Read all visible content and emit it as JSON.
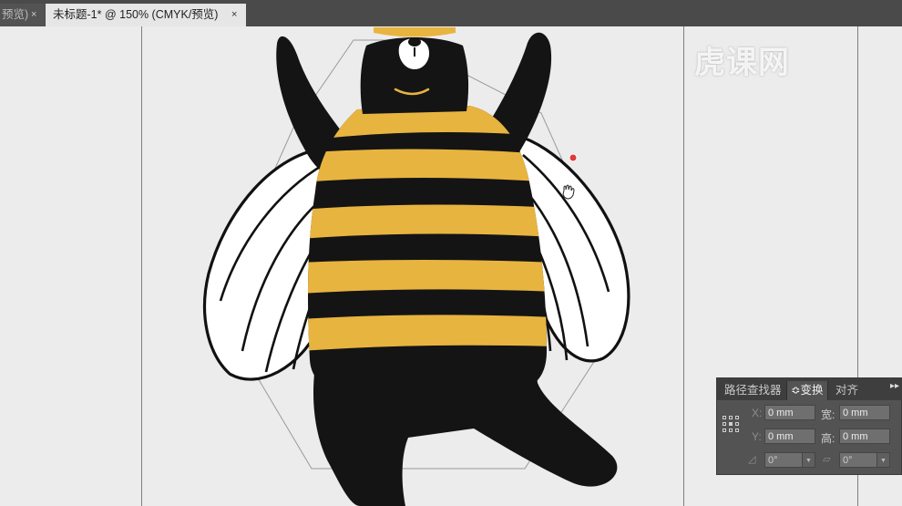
{
  "tabs": [
    {
      "label": "预览)",
      "close": "×"
    },
    {
      "label": "未标题-1* @ 150% (CMYK/预览)",
      "close": "×"
    }
  ],
  "watermark": "虎课网",
  "colors": {
    "bee_yellow": "#e8b440",
    "bear_black": "#141414",
    "panel_bg": "#535353",
    "cursor_dot": "#e03a3a"
  },
  "panel": {
    "tabs": [
      "路径查找器",
      "变换",
      "对齐"
    ],
    "active_tab": "变换",
    "active_tab_prefix": "≎",
    "menu": "▸▸",
    "fields": {
      "x_label": "X:",
      "x_value": "0 mm",
      "y_label": "Y:",
      "y_value": "0 mm",
      "w_label": "宽:",
      "w_value": "0 mm",
      "h_label": "高:",
      "h_value": "0 mm",
      "rotate_value": "0°",
      "shear_value": "0°"
    },
    "icons": [
      "reference-point-icon",
      "rotate-icon",
      "shear-icon",
      "dropdown-arrow-icon"
    ]
  }
}
